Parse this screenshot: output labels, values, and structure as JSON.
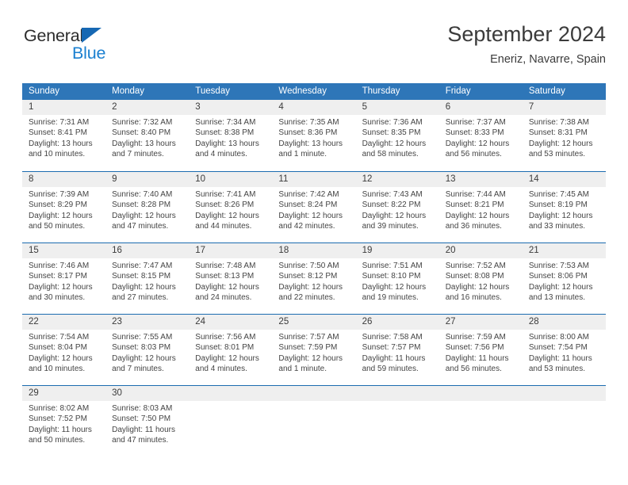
{
  "brand": {
    "name_top": "General",
    "name_bottom": "Blue",
    "triangle_color": "#1668b3",
    "blue_color": "#1b80d0"
  },
  "header": {
    "title": "September 2024",
    "subtitle": "Eneriz, Navarre, Spain"
  },
  "theme": {
    "header_bar_color": "#2e76b8",
    "row_divider_color": "#1c6cb0",
    "daynum_band_color": "#efefef",
    "header_text_color": "#ffffff",
    "body_text_color": "#444444"
  },
  "calendar": {
    "weekday_headers": [
      "Sunday",
      "Monday",
      "Tuesday",
      "Wednesday",
      "Thursday",
      "Friday",
      "Saturday"
    ],
    "weeks": [
      [
        {
          "day": "1",
          "sunrise": "Sunrise: 7:31 AM",
          "sunset": "Sunset: 8:41 PM",
          "daylight_1": "Daylight: 13 hours",
          "daylight_2": "and 10 minutes."
        },
        {
          "day": "2",
          "sunrise": "Sunrise: 7:32 AM",
          "sunset": "Sunset: 8:40 PM",
          "daylight_1": "Daylight: 13 hours",
          "daylight_2": "and 7 minutes."
        },
        {
          "day": "3",
          "sunrise": "Sunrise: 7:34 AM",
          "sunset": "Sunset: 8:38 PM",
          "daylight_1": "Daylight: 13 hours",
          "daylight_2": "and 4 minutes."
        },
        {
          "day": "4",
          "sunrise": "Sunrise: 7:35 AM",
          "sunset": "Sunset: 8:36 PM",
          "daylight_1": "Daylight: 13 hours",
          "daylight_2": "and 1 minute."
        },
        {
          "day": "5",
          "sunrise": "Sunrise: 7:36 AM",
          "sunset": "Sunset: 8:35 PM",
          "daylight_1": "Daylight: 12 hours",
          "daylight_2": "and 58 minutes."
        },
        {
          "day": "6",
          "sunrise": "Sunrise: 7:37 AM",
          "sunset": "Sunset: 8:33 PM",
          "daylight_1": "Daylight: 12 hours",
          "daylight_2": "and 56 minutes."
        },
        {
          "day": "7",
          "sunrise": "Sunrise: 7:38 AM",
          "sunset": "Sunset: 8:31 PM",
          "daylight_1": "Daylight: 12 hours",
          "daylight_2": "and 53 minutes."
        }
      ],
      [
        {
          "day": "8",
          "sunrise": "Sunrise: 7:39 AM",
          "sunset": "Sunset: 8:29 PM",
          "daylight_1": "Daylight: 12 hours",
          "daylight_2": "and 50 minutes."
        },
        {
          "day": "9",
          "sunrise": "Sunrise: 7:40 AM",
          "sunset": "Sunset: 8:28 PM",
          "daylight_1": "Daylight: 12 hours",
          "daylight_2": "and 47 minutes."
        },
        {
          "day": "10",
          "sunrise": "Sunrise: 7:41 AM",
          "sunset": "Sunset: 8:26 PM",
          "daylight_1": "Daylight: 12 hours",
          "daylight_2": "and 44 minutes."
        },
        {
          "day": "11",
          "sunrise": "Sunrise: 7:42 AM",
          "sunset": "Sunset: 8:24 PM",
          "daylight_1": "Daylight: 12 hours",
          "daylight_2": "and 42 minutes."
        },
        {
          "day": "12",
          "sunrise": "Sunrise: 7:43 AM",
          "sunset": "Sunset: 8:22 PM",
          "daylight_1": "Daylight: 12 hours",
          "daylight_2": "and 39 minutes."
        },
        {
          "day": "13",
          "sunrise": "Sunrise: 7:44 AM",
          "sunset": "Sunset: 8:21 PM",
          "daylight_1": "Daylight: 12 hours",
          "daylight_2": "and 36 minutes."
        },
        {
          "day": "14",
          "sunrise": "Sunrise: 7:45 AM",
          "sunset": "Sunset: 8:19 PM",
          "daylight_1": "Daylight: 12 hours",
          "daylight_2": "and 33 minutes."
        }
      ],
      [
        {
          "day": "15",
          "sunrise": "Sunrise: 7:46 AM",
          "sunset": "Sunset: 8:17 PM",
          "daylight_1": "Daylight: 12 hours",
          "daylight_2": "and 30 minutes."
        },
        {
          "day": "16",
          "sunrise": "Sunrise: 7:47 AM",
          "sunset": "Sunset: 8:15 PM",
          "daylight_1": "Daylight: 12 hours",
          "daylight_2": "and 27 minutes."
        },
        {
          "day": "17",
          "sunrise": "Sunrise: 7:48 AM",
          "sunset": "Sunset: 8:13 PM",
          "daylight_1": "Daylight: 12 hours",
          "daylight_2": "and 24 minutes."
        },
        {
          "day": "18",
          "sunrise": "Sunrise: 7:50 AM",
          "sunset": "Sunset: 8:12 PM",
          "daylight_1": "Daylight: 12 hours",
          "daylight_2": "and 22 minutes."
        },
        {
          "day": "19",
          "sunrise": "Sunrise: 7:51 AM",
          "sunset": "Sunset: 8:10 PM",
          "daylight_1": "Daylight: 12 hours",
          "daylight_2": "and 19 minutes."
        },
        {
          "day": "20",
          "sunrise": "Sunrise: 7:52 AM",
          "sunset": "Sunset: 8:08 PM",
          "daylight_1": "Daylight: 12 hours",
          "daylight_2": "and 16 minutes."
        },
        {
          "day": "21",
          "sunrise": "Sunrise: 7:53 AM",
          "sunset": "Sunset: 8:06 PM",
          "daylight_1": "Daylight: 12 hours",
          "daylight_2": "and 13 minutes."
        }
      ],
      [
        {
          "day": "22",
          "sunrise": "Sunrise: 7:54 AM",
          "sunset": "Sunset: 8:04 PM",
          "daylight_1": "Daylight: 12 hours",
          "daylight_2": "and 10 minutes."
        },
        {
          "day": "23",
          "sunrise": "Sunrise: 7:55 AM",
          "sunset": "Sunset: 8:03 PM",
          "daylight_1": "Daylight: 12 hours",
          "daylight_2": "and 7 minutes."
        },
        {
          "day": "24",
          "sunrise": "Sunrise: 7:56 AM",
          "sunset": "Sunset: 8:01 PM",
          "daylight_1": "Daylight: 12 hours",
          "daylight_2": "and 4 minutes."
        },
        {
          "day": "25",
          "sunrise": "Sunrise: 7:57 AM",
          "sunset": "Sunset: 7:59 PM",
          "daylight_1": "Daylight: 12 hours",
          "daylight_2": "and 1 minute."
        },
        {
          "day": "26",
          "sunrise": "Sunrise: 7:58 AM",
          "sunset": "Sunset: 7:57 PM",
          "daylight_1": "Daylight: 11 hours",
          "daylight_2": "and 59 minutes."
        },
        {
          "day": "27",
          "sunrise": "Sunrise: 7:59 AM",
          "sunset": "Sunset: 7:56 PM",
          "daylight_1": "Daylight: 11 hours",
          "daylight_2": "and 56 minutes."
        },
        {
          "day": "28",
          "sunrise": "Sunrise: 8:00 AM",
          "sunset": "Sunset: 7:54 PM",
          "daylight_1": "Daylight: 11 hours",
          "daylight_2": "and 53 minutes."
        }
      ],
      [
        {
          "day": "29",
          "sunrise": "Sunrise: 8:02 AM",
          "sunset": "Sunset: 7:52 PM",
          "daylight_1": "Daylight: 11 hours",
          "daylight_2": "and 50 minutes."
        },
        {
          "day": "30",
          "sunrise": "Sunrise: 8:03 AM",
          "sunset": "Sunset: 7:50 PM",
          "daylight_1": "Daylight: 11 hours",
          "daylight_2": "and 47 minutes."
        },
        {
          "day": "",
          "sunrise": "",
          "sunset": "",
          "daylight_1": "",
          "daylight_2": ""
        },
        {
          "day": "",
          "sunrise": "",
          "sunset": "",
          "daylight_1": "",
          "daylight_2": ""
        },
        {
          "day": "",
          "sunrise": "",
          "sunset": "",
          "daylight_1": "",
          "daylight_2": ""
        },
        {
          "day": "",
          "sunrise": "",
          "sunset": "",
          "daylight_1": "",
          "daylight_2": ""
        },
        {
          "day": "",
          "sunrise": "",
          "sunset": "",
          "daylight_1": "",
          "daylight_2": ""
        }
      ]
    ]
  }
}
